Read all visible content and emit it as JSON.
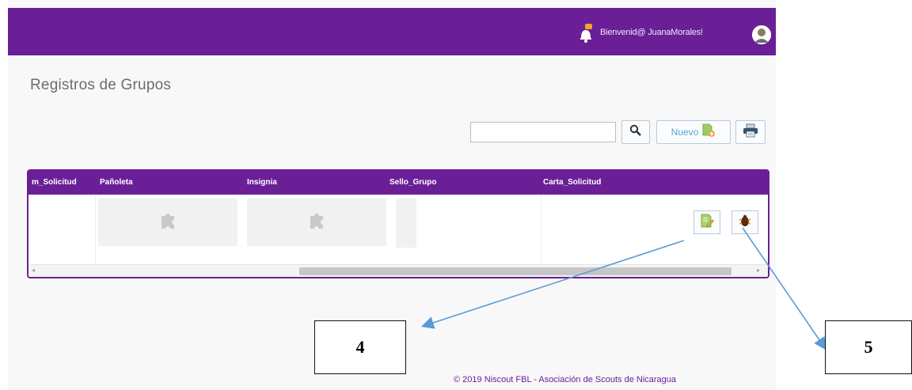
{
  "header": {
    "welcome_text": "Bienvenid@ JuanaMorales!",
    "bell_icon": "bell-icon",
    "avatar_icon": "user-avatar-icon",
    "brand_color": "#6a1f97"
  },
  "main": {
    "title": "Registros de Grupos",
    "search": {
      "value": "",
      "placeholder": ""
    },
    "buttons": {
      "search_icon": "magnifier-icon",
      "new_label": "Nuevo",
      "new_icon": "add-document-icon",
      "print_icon": "printer-icon"
    }
  },
  "table": {
    "columns": [
      "m_Solicitud",
      "Pañoleta",
      "Insignia",
      "Sello_Grupo",
      "Carta_Solicitud"
    ],
    "rows": [
      {
        "cells": [
          "",
          "puzzle-placeholder-icon",
          "puzzle-placeholder-icon",
          "",
          ""
        ],
        "actions": [
          "edit-icon",
          "delete-icon"
        ]
      }
    ]
  },
  "footer": {
    "text": "© 2019 Niscout FBL - Asociación de Scouts de Nicaragua"
  },
  "annotations": {
    "callouts": [
      {
        "label": "4",
        "target": "edit-button"
      },
      {
        "label": "5",
        "target": "delete-button"
      }
    ],
    "arrow_color": "#5b9bd5"
  }
}
